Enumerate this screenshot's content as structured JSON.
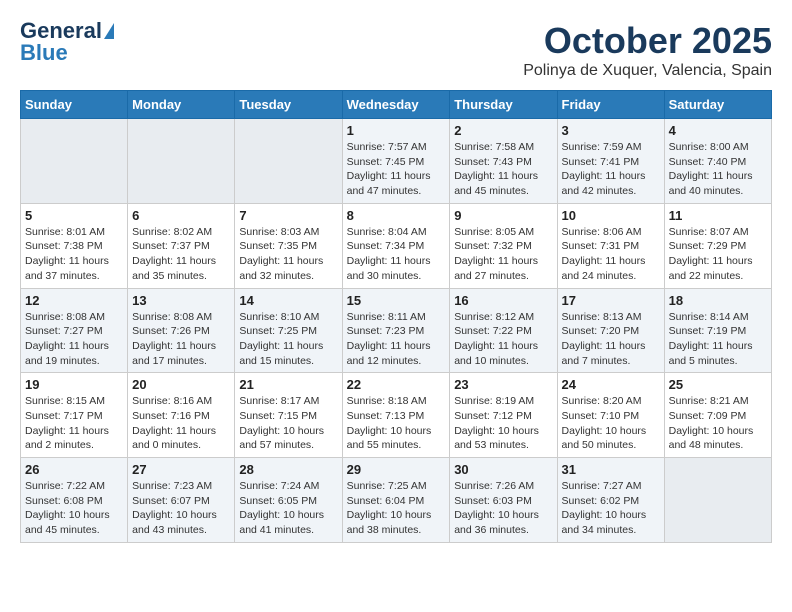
{
  "logo": {
    "line1": "General",
    "line2": "Blue"
  },
  "title": "October 2025",
  "subtitle": "Polinya de Xuquer, Valencia, Spain",
  "days_header": [
    "Sunday",
    "Monday",
    "Tuesday",
    "Wednesday",
    "Thursday",
    "Friday",
    "Saturday"
  ],
  "weeks": [
    [
      {
        "day": "",
        "info": ""
      },
      {
        "day": "",
        "info": ""
      },
      {
        "day": "",
        "info": ""
      },
      {
        "day": "1",
        "info": "Sunrise: 7:57 AM\nSunset: 7:45 PM\nDaylight: 11 hours\nand 47 minutes."
      },
      {
        "day": "2",
        "info": "Sunrise: 7:58 AM\nSunset: 7:43 PM\nDaylight: 11 hours\nand 45 minutes."
      },
      {
        "day": "3",
        "info": "Sunrise: 7:59 AM\nSunset: 7:41 PM\nDaylight: 11 hours\nand 42 minutes."
      },
      {
        "day": "4",
        "info": "Sunrise: 8:00 AM\nSunset: 7:40 PM\nDaylight: 11 hours\nand 40 minutes."
      }
    ],
    [
      {
        "day": "5",
        "info": "Sunrise: 8:01 AM\nSunset: 7:38 PM\nDaylight: 11 hours\nand 37 minutes."
      },
      {
        "day": "6",
        "info": "Sunrise: 8:02 AM\nSunset: 7:37 PM\nDaylight: 11 hours\nand 35 minutes."
      },
      {
        "day": "7",
        "info": "Sunrise: 8:03 AM\nSunset: 7:35 PM\nDaylight: 11 hours\nand 32 minutes."
      },
      {
        "day": "8",
        "info": "Sunrise: 8:04 AM\nSunset: 7:34 PM\nDaylight: 11 hours\nand 30 minutes."
      },
      {
        "day": "9",
        "info": "Sunrise: 8:05 AM\nSunset: 7:32 PM\nDaylight: 11 hours\nand 27 minutes."
      },
      {
        "day": "10",
        "info": "Sunrise: 8:06 AM\nSunset: 7:31 PM\nDaylight: 11 hours\nand 24 minutes."
      },
      {
        "day": "11",
        "info": "Sunrise: 8:07 AM\nSunset: 7:29 PM\nDaylight: 11 hours\nand 22 minutes."
      }
    ],
    [
      {
        "day": "12",
        "info": "Sunrise: 8:08 AM\nSunset: 7:27 PM\nDaylight: 11 hours\nand 19 minutes."
      },
      {
        "day": "13",
        "info": "Sunrise: 8:08 AM\nSunset: 7:26 PM\nDaylight: 11 hours\nand 17 minutes."
      },
      {
        "day": "14",
        "info": "Sunrise: 8:10 AM\nSunset: 7:25 PM\nDaylight: 11 hours\nand 15 minutes."
      },
      {
        "day": "15",
        "info": "Sunrise: 8:11 AM\nSunset: 7:23 PM\nDaylight: 11 hours\nand 12 minutes."
      },
      {
        "day": "16",
        "info": "Sunrise: 8:12 AM\nSunset: 7:22 PM\nDaylight: 11 hours\nand 10 minutes."
      },
      {
        "day": "17",
        "info": "Sunrise: 8:13 AM\nSunset: 7:20 PM\nDaylight: 11 hours\nand 7 minutes."
      },
      {
        "day": "18",
        "info": "Sunrise: 8:14 AM\nSunset: 7:19 PM\nDaylight: 11 hours\nand 5 minutes."
      }
    ],
    [
      {
        "day": "19",
        "info": "Sunrise: 8:15 AM\nSunset: 7:17 PM\nDaylight: 11 hours\nand 2 minutes."
      },
      {
        "day": "20",
        "info": "Sunrise: 8:16 AM\nSunset: 7:16 PM\nDaylight: 11 hours\nand 0 minutes."
      },
      {
        "day": "21",
        "info": "Sunrise: 8:17 AM\nSunset: 7:15 PM\nDaylight: 10 hours\nand 57 minutes."
      },
      {
        "day": "22",
        "info": "Sunrise: 8:18 AM\nSunset: 7:13 PM\nDaylight: 10 hours\nand 55 minutes."
      },
      {
        "day": "23",
        "info": "Sunrise: 8:19 AM\nSunset: 7:12 PM\nDaylight: 10 hours\nand 53 minutes."
      },
      {
        "day": "24",
        "info": "Sunrise: 8:20 AM\nSunset: 7:10 PM\nDaylight: 10 hours\nand 50 minutes."
      },
      {
        "day": "25",
        "info": "Sunrise: 8:21 AM\nSunset: 7:09 PM\nDaylight: 10 hours\nand 48 minutes."
      }
    ],
    [
      {
        "day": "26",
        "info": "Sunrise: 7:22 AM\nSunset: 6:08 PM\nDaylight: 10 hours\nand 45 minutes."
      },
      {
        "day": "27",
        "info": "Sunrise: 7:23 AM\nSunset: 6:07 PM\nDaylight: 10 hours\nand 43 minutes."
      },
      {
        "day": "28",
        "info": "Sunrise: 7:24 AM\nSunset: 6:05 PM\nDaylight: 10 hours\nand 41 minutes."
      },
      {
        "day": "29",
        "info": "Sunrise: 7:25 AM\nSunset: 6:04 PM\nDaylight: 10 hours\nand 38 minutes."
      },
      {
        "day": "30",
        "info": "Sunrise: 7:26 AM\nSunset: 6:03 PM\nDaylight: 10 hours\nand 36 minutes."
      },
      {
        "day": "31",
        "info": "Sunrise: 7:27 AM\nSunset: 6:02 PM\nDaylight: 10 hours\nand 34 minutes."
      },
      {
        "day": "",
        "info": ""
      }
    ]
  ]
}
